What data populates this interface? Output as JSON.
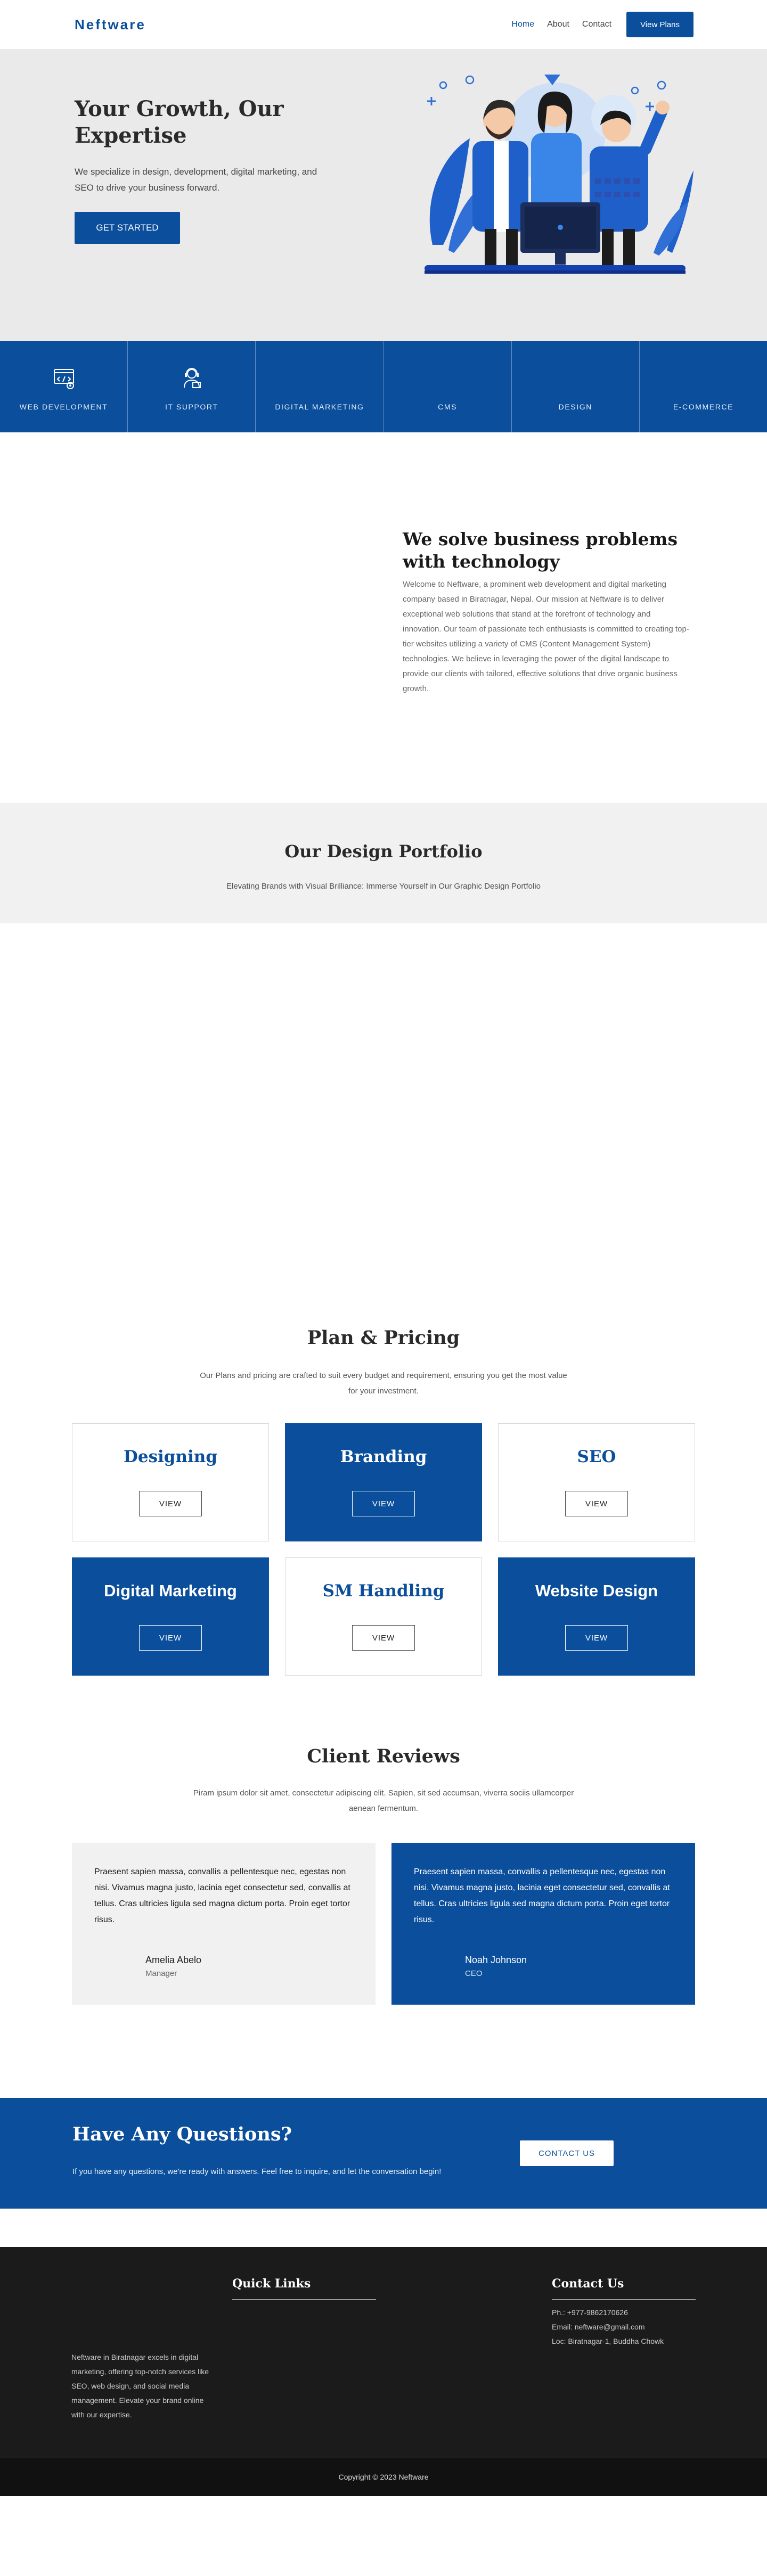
{
  "colors": {
    "brand": "#0b4f9c",
    "hero_bg": "#eaeaea",
    "footer_bg": "#1b1b1b"
  },
  "nav": {
    "logo": "Neftware",
    "links": [
      "Home",
      "About",
      "Contact"
    ],
    "active": "Home",
    "cta": "View Plans"
  },
  "hero": {
    "title": "Your Growth, Our Expertise",
    "subtitle": "We specialize in design, development, digital marketing, and SEO to drive your business forward.",
    "button": "GET STARTED"
  },
  "services": [
    {
      "label": "WEB DEVELOPMENT",
      "icon": "web-development-icon"
    },
    {
      "label": "IT SUPPORT",
      "icon": "it-support-icon"
    },
    {
      "label": "DIGITAL MARKETING",
      "icon": ""
    },
    {
      "label": "CMS",
      "icon": ""
    },
    {
      "label": "DESIGN",
      "icon": ""
    },
    {
      "label": "E-COMMERCE",
      "icon": ""
    }
  ],
  "about": {
    "title": "We solve business problems with technology",
    "body": "Welcome to Neftware, a prominent web development and digital marketing company based in Biratnagar, Nepal. Our mission at Neftware is to deliver exceptional web solutions that stand at the forefront of technology and innovation. Our team of passionate tech enthusiasts is committed to creating top-tier websites utilizing a variety of CMS (Content Management System) technologies. We believe in leveraging the power of the digital landscape to provide our clients with tailored, effective solutions that drive organic business growth."
  },
  "portfolio": {
    "title": "Our Design Portfolio",
    "subtitle": "Elevating Brands with Visual Brilliance: Immerse Yourself in Our Graphic Design Portfolio"
  },
  "pricing": {
    "title": "Plan & Pricing",
    "subtitle": "Our Plans and pricing are crafted to suit every budget and requirement, ensuring you get the most value for your investment.",
    "button": "VIEW",
    "plans": [
      {
        "name": "Designing",
        "style": "light"
      },
      {
        "name": "Branding",
        "style": "blue"
      },
      {
        "name": "SEO",
        "style": "light"
      },
      {
        "name": "Digital Marketing",
        "style": "blue"
      },
      {
        "name": "SM Handling",
        "style": "light"
      },
      {
        "name": "Website Design",
        "style": "blue"
      }
    ]
  },
  "reviews": {
    "title": "Client Reviews",
    "subtitle": "Piram ipsum dolor sit amet, consectetur adipiscing elit. Sapien, sit sed accumsan, viverra sociis ullamcorper aenean fermentum.",
    "items": [
      {
        "quote": "Praesent sapien massa, convallis a pellentesque nec, egestas non nisi. Vivamus magna justo, lacinia eget consectetur sed, convallis at tellus. Cras ultricies ligula sed magna dictum porta. Proin eget tortor risus.",
        "name": "Amelia Abelo",
        "role": "Manager"
      },
      {
        "quote": "Praesent sapien massa, convallis a pellentesque nec, egestas non nisi. Vivamus magna justo, lacinia eget consectetur sed, convallis at tellus. Cras ultricies ligula sed magna dictum porta. Proin eget tortor risus.",
        "name": "Noah Johnson",
        "role": "CEO"
      }
    ]
  },
  "cta": {
    "title": "Have Any Questions?",
    "subtitle": "If you have any questions, we're ready with answers. Feel free to inquire, and let the conversation begin!",
    "button": "CONTACT US"
  },
  "footer": {
    "quick_links_title": "Quick Links",
    "contact_title": "Contact Us",
    "phone": "Ph.: +977-9862170626",
    "email": "Email: neftware@gmail.com",
    "location": "Loc: Biratnagar-1, Buddha Chowk",
    "about": "Neftware in Biratnagar excels in digital marketing, offering top-notch services like SEO, web design, and social media management. Elevate your brand online with our expertise.",
    "copyright": "Copyright © 2023 Neftware"
  }
}
